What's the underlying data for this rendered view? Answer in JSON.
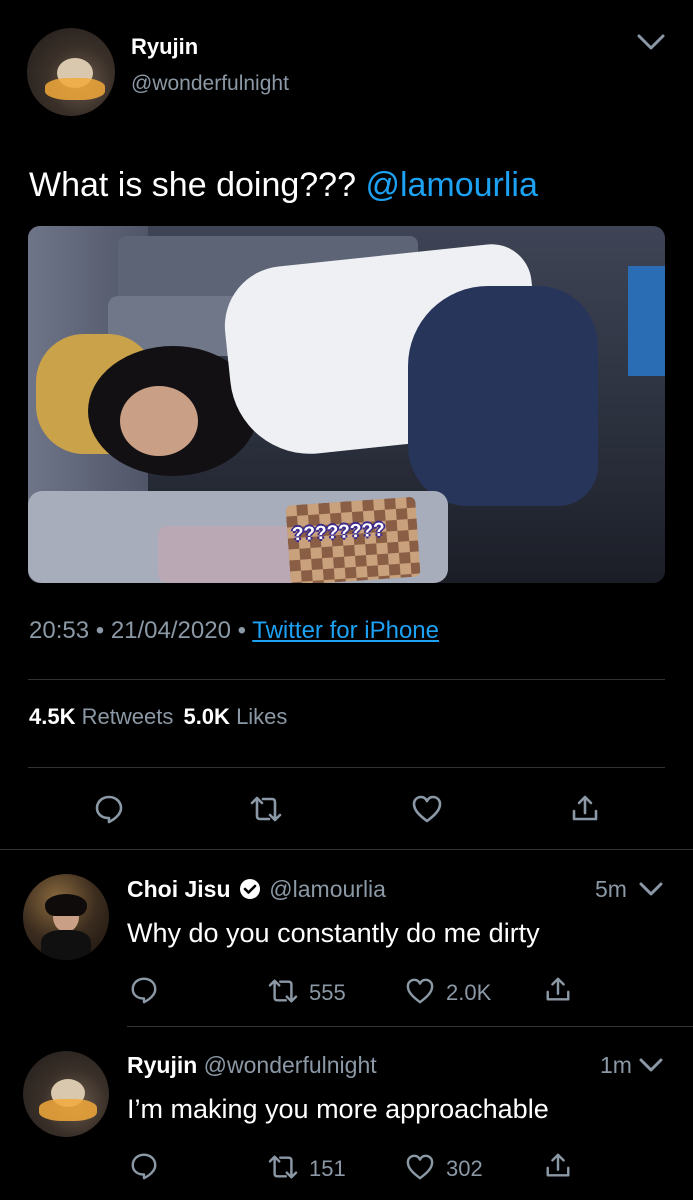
{
  "tweet": {
    "author_name": "Ryujin",
    "author_handle": "@wonderfulnight",
    "text": "What is she doing???",
    "mention": "@lamourlia",
    "image_caption": "????????",
    "time": "20:53",
    "dot1": "•",
    "date": "21/04/2020",
    "dot2": "•",
    "source": "Twitter for iPhone",
    "retweets_count": "4.5K",
    "retweets_label": "Retweets",
    "likes_count": "5.0K",
    "likes_label": "Likes"
  },
  "replies": [
    {
      "name": "Choi Jisu",
      "handle": "@lamourlia",
      "time": "5m",
      "text": "Why do you constantly do me dirty",
      "retweets": "555",
      "likes": "2.0K",
      "verified": true
    },
    {
      "name": "Ryujin",
      "handle": "@wonderfulnight",
      "time": "1m",
      "text": "I’m making you more approachable",
      "retweets": "151",
      "likes": "302",
      "verified": false
    }
  ],
  "colors": {
    "background": "#000000",
    "accent": "#1da1f2",
    "muted": "#8b98a5",
    "divider": "#2f3336"
  },
  "icons": [
    "chevron-down-icon",
    "reply-icon",
    "retweet-icon",
    "like-icon",
    "share-icon",
    "verified-badge-icon"
  ]
}
